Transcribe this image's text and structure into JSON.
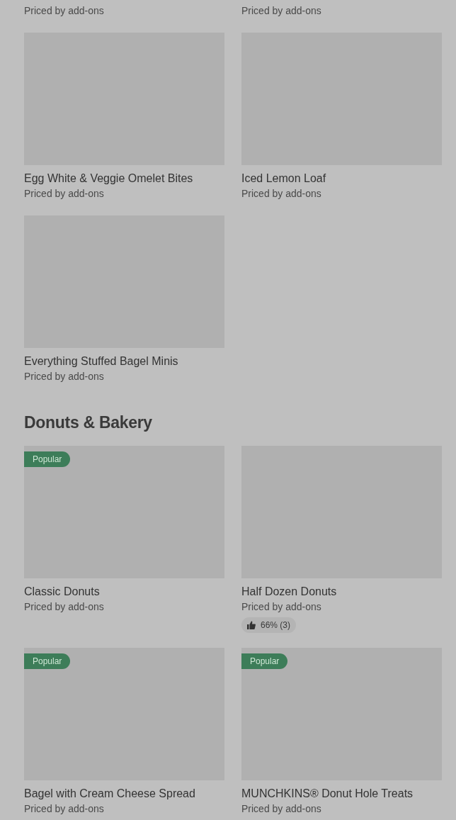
{
  "sections": [
    {
      "items": [
        {
          "price": "Priced by add-ons"
        },
        {
          "price": "Priced by add-ons"
        },
        {
          "name": "Egg White & Veggie Omelet Bites",
          "price": "Priced by add-ons"
        },
        {
          "name": "Iced Lemon Loaf",
          "price": "Priced by add-ons"
        },
        {
          "name": "Everything Stuffed Bagel Minis",
          "price": "Priced by add-ons"
        }
      ]
    },
    {
      "title": "Donuts & Bakery",
      "items": [
        {
          "name": "Classic Donuts",
          "price": "Priced by add-ons",
          "badge": "Popular"
        },
        {
          "name": "Half Dozen Donuts",
          "price": "Priced by add-ons",
          "rating": "66% (3)"
        },
        {
          "name": "Bagel with Cream Cheese Spread",
          "price": "Priced by add-ons",
          "badge": "Popular"
        },
        {
          "name": "MUNCHKINS® Donut Hole Treats",
          "price": "Priced by add-ons",
          "badge": "Popular"
        }
      ]
    }
  ]
}
